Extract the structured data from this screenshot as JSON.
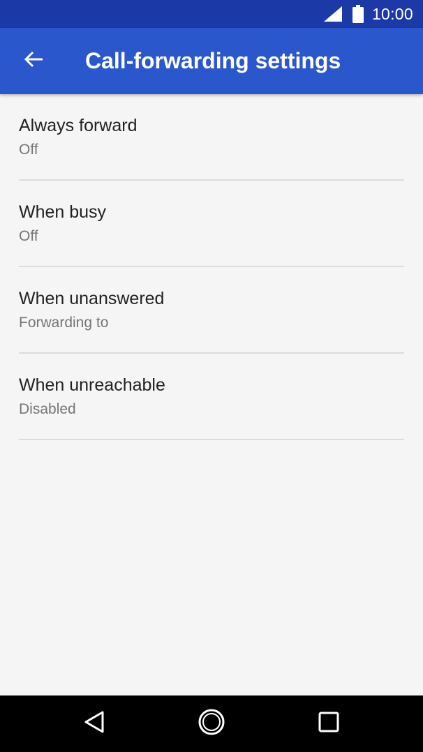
{
  "status_bar": {
    "time": "10:00",
    "icons": [
      "signal-icon",
      "battery-icon"
    ]
  },
  "app_bar": {
    "back_icon": "arrow-back-icon",
    "title": "Call-forwarding settings"
  },
  "settings": [
    {
      "title": "Always forward",
      "summary": "Off"
    },
    {
      "title": "When busy",
      "summary": "Off"
    },
    {
      "title": "When unanswered",
      "summary": "Forwarding to"
    },
    {
      "title": "When unreachable",
      "summary": "Disabled"
    }
  ],
  "nav_bar": {
    "icons": [
      "back-triangle-icon",
      "home-circle-icon",
      "recents-square-icon"
    ]
  },
  "colors": {
    "status_bar": "#1c39a8",
    "app_bar": "#2b57cc",
    "background": "#f5f5f5",
    "divider": "#dcdcdc",
    "primary_text": "#212121",
    "secondary_text": "#757575"
  }
}
